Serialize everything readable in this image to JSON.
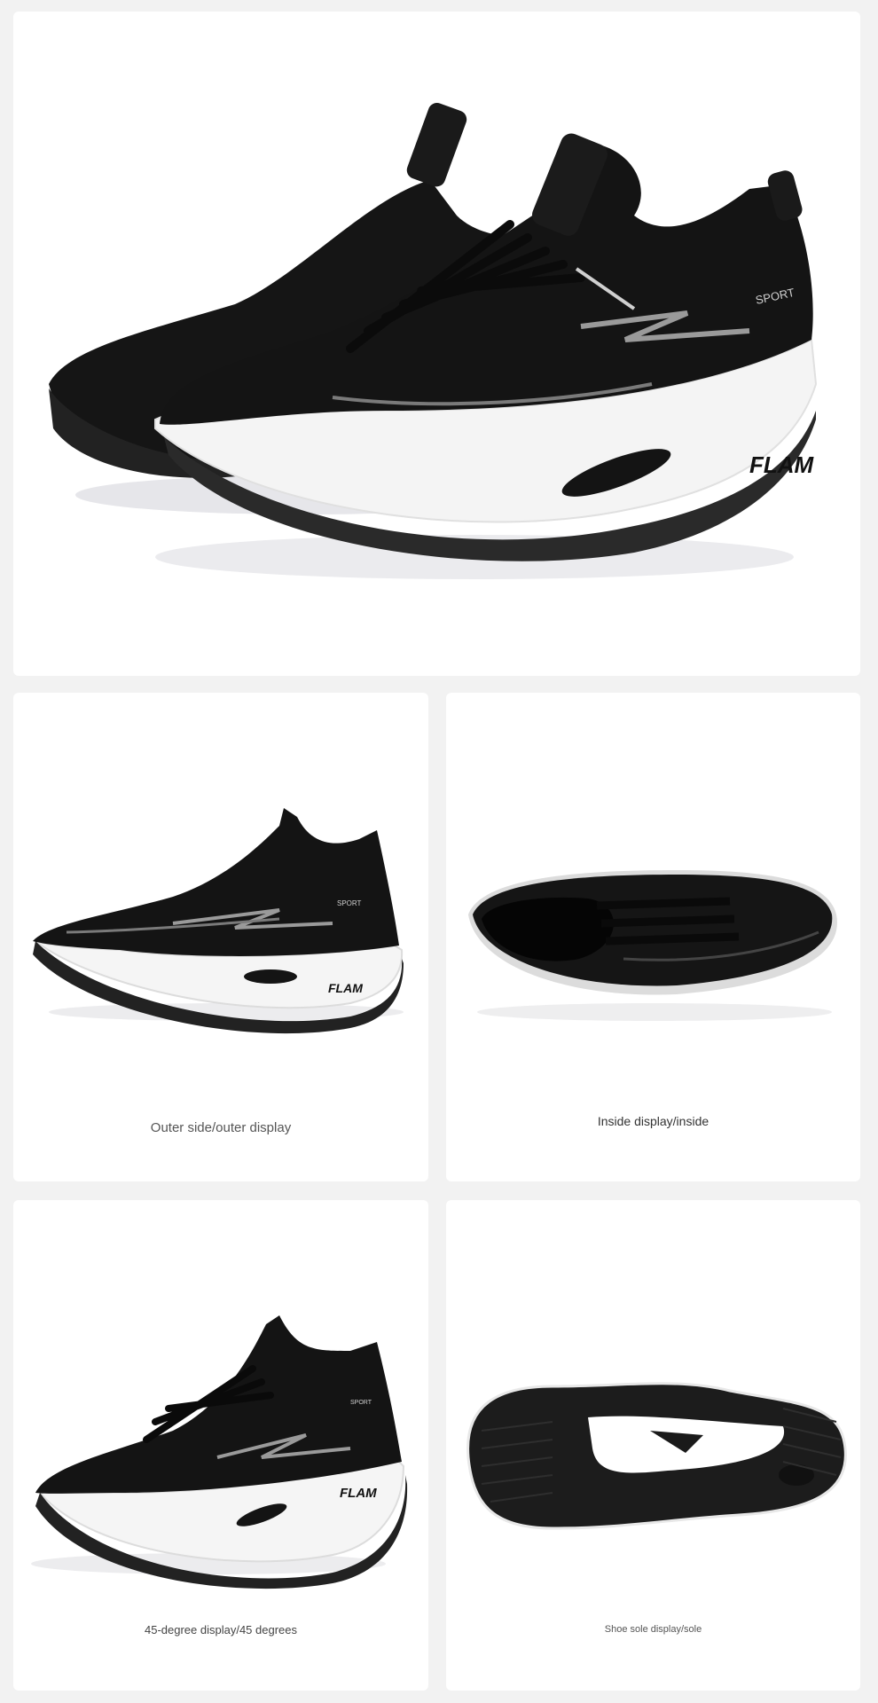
{
  "photos": {
    "hero": {
      "alt": "",
      "brand_mark": "FLAM",
      "side_text": "SPORT"
    },
    "outer": {
      "caption": "Outer side/outer display",
      "brand_mark": "FLAM",
      "side_text": "SPORT"
    },
    "inside": {
      "caption": "Inside display/inside"
    },
    "deg45": {
      "caption": "45-degree display/45 degrees",
      "brand_mark": "FLAM",
      "side_text": "SPORT"
    },
    "sole": {
      "caption": "Shoe sole display/sole"
    }
  },
  "colors": {
    "background": "#f2f2f2",
    "card": "#ffffff",
    "upper": "#141414",
    "midsole": "#f4f4f4",
    "accent": "#9a9a9a"
  }
}
